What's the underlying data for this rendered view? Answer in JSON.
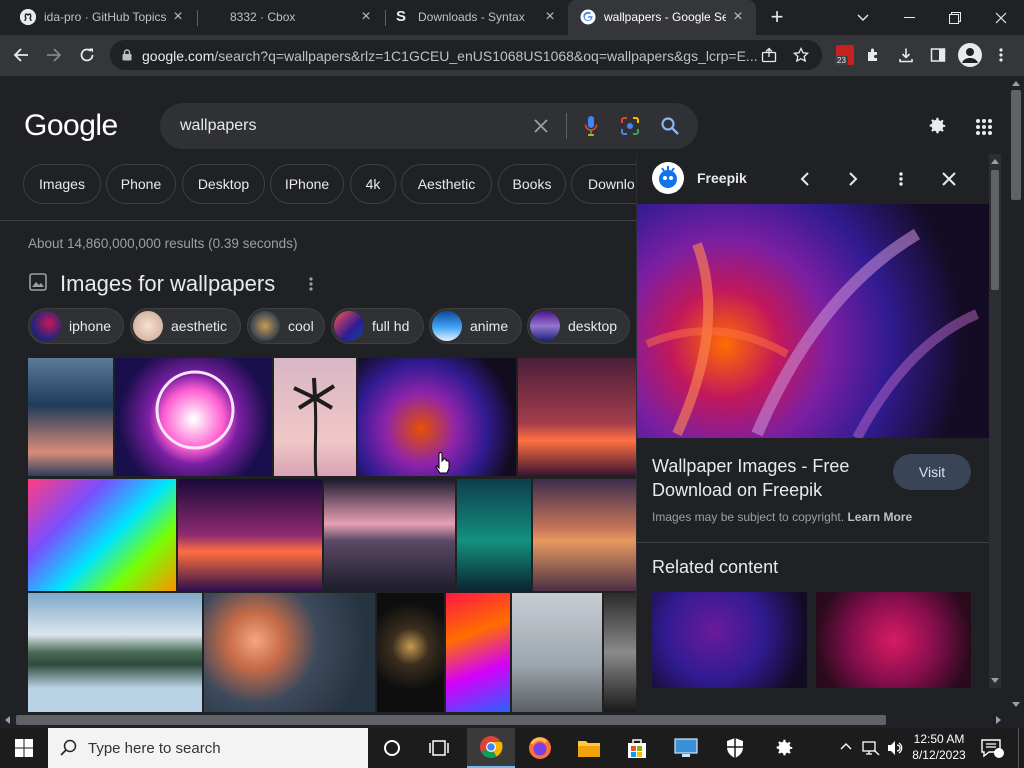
{
  "browser": {
    "tabs": [
      {
        "title": "ida-pro · GitHub Topics",
        "close": "×"
      },
      {
        "title": "8332 · Cbox",
        "close": "×"
      },
      {
        "title": "Downloads - Syntax",
        "close": "×"
      },
      {
        "title": "wallpapers - Google Se",
        "close": "×"
      }
    ],
    "new_tab": "+",
    "url_host": "google.com",
    "url_rest": "/search?q=wallpapers&rlz=1C1GCEU_enUS1068US1068&oq=wallpapers&gs_lcrp=E...",
    "ext_badge": "23"
  },
  "search": {
    "logo": "Google",
    "query": "wallpapers",
    "tabs": [
      "Images",
      "Phone",
      "Desktop",
      "IPhone",
      "4k",
      "Aesthetic",
      "Books",
      "Downlo"
    ],
    "stats": "About 14,860,000,000 results (0.39 seconds)",
    "images_heading": "Images for wallpapers",
    "filters": [
      "iphone",
      "aesthetic",
      "cool",
      "full hd",
      "anime",
      "desktop"
    ]
  },
  "panel": {
    "source": "Freepik",
    "title_line1": "Wallpaper Images - Free",
    "title_line2": "Download on Freepik",
    "visit": "Visit",
    "copyright": "Images may be subject to copyright.",
    "learn_more": "Learn More",
    "related": "Related content"
  },
  "taskbar": {
    "search_placeholder": "Type here to search",
    "time": "12:50 AM",
    "date": "8/12/2023"
  },
  "colors": {
    "page_bg": "#202124",
    "accent_blue": "#8ab4f8",
    "chrome_dark": "#35363a"
  }
}
